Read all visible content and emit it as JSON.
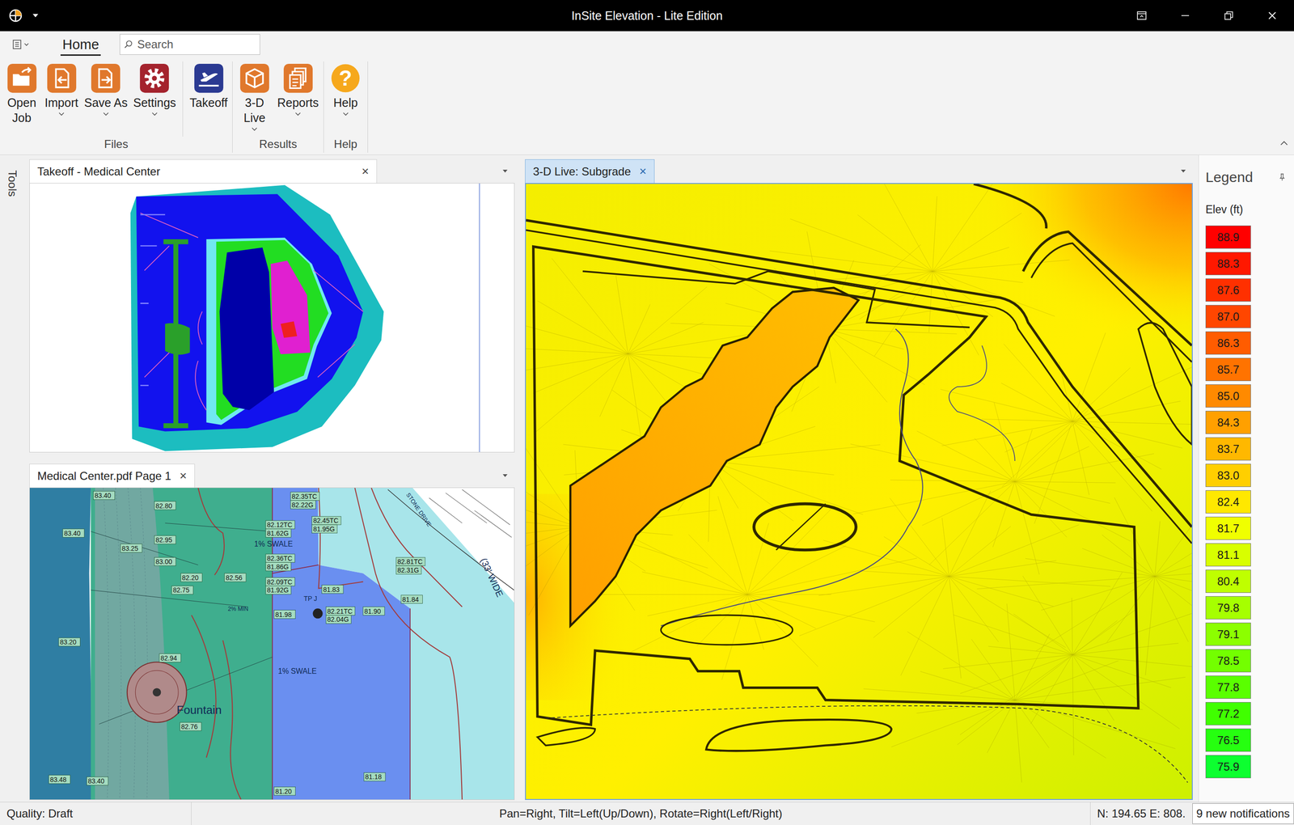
{
  "window": {
    "title": "InSite Elevation - Lite Edition"
  },
  "ribbon": {
    "tabs": [
      {
        "label": "Home",
        "selected": true
      }
    ],
    "search": {
      "placeholder": "Search"
    },
    "groups": [
      {
        "label": "Files",
        "buttons": [
          {
            "lines": [
              "Open",
              "Job"
            ],
            "kind": "open",
            "color": "#e0782c",
            "dropdown": false,
            "separator": false,
            "glyph": ""
          },
          {
            "lines": [
              "Import"
            ],
            "kind": "import",
            "color": "#e0782c",
            "dropdown": true,
            "separator": false,
            "glyph": ""
          },
          {
            "lines": [
              "Save As"
            ],
            "kind": "saveas",
            "color": "#e0782c",
            "dropdown": true,
            "separator": false,
            "glyph": ""
          },
          {
            "lines": [
              "Settings"
            ],
            "kind": "settings",
            "color": "#a4232d",
            "dropdown": true,
            "separator": false,
            "glyph": ""
          },
          {
            "lines": [
              "Takeoff"
            ],
            "kind": "takeoff",
            "color": "#2b3a92",
            "dropdown": false,
            "separator": true,
            "glyph": ""
          }
        ]
      },
      {
        "label": "Results",
        "buttons": [
          {
            "lines": [
              "3-D",
              "Live"
            ],
            "kind": "live3d",
            "color": "#e0782c",
            "dropdown": true,
            "separator": false,
            "glyph": ""
          },
          {
            "lines": [
              "Reports"
            ],
            "kind": "reports",
            "color": "#e0782c",
            "dropdown": true,
            "separator": false,
            "glyph": ""
          }
        ]
      },
      {
        "label": "Help",
        "buttons": [
          {
            "lines": [
              "Help"
            ],
            "kind": "help",
            "color": "#f6a81c",
            "dropdown": true,
            "separator": false,
            "glyph": "?"
          }
        ]
      }
    ]
  },
  "tools": {
    "label": "Tools"
  },
  "takeoff_panel": {
    "tab": {
      "label": "Takeoff - Medical Center",
      "close": "×",
      "selected": false
    }
  },
  "pdf_panel": {
    "tab": {
      "label": "Medical Center.pdf Page 1",
      "close": "×",
      "selected": false
    },
    "labels": [
      {
        "text": "83.40",
        "kind": "spot"
      },
      {
        "text": "82.80",
        "kind": "spot"
      },
      {
        "text": "83.40",
        "kind": "spot"
      },
      {
        "text": "83.25",
        "kind": "spot"
      },
      {
        "text": "82.95",
        "kind": "spot"
      },
      {
        "text": "83.00",
        "kind": "spot"
      },
      {
        "text": "82.20",
        "kind": "spot"
      },
      {
        "text": "82.56",
        "kind": "spot"
      },
      {
        "text": "82.75",
        "kind": "spot"
      },
      {
        "text": "83.20",
        "kind": "spot"
      },
      {
        "text": "82.94",
        "kind": "spot"
      },
      {
        "text": "82.76",
        "kind": "spot"
      },
      {
        "text": "83.48",
        "kind": "spot"
      },
      {
        "text": "83.40",
        "kind": "spot"
      },
      {
        "text": "82.35TC",
        "kind": "spot"
      },
      {
        "text": "82.22G",
        "kind": "spot"
      },
      {
        "text": "82.12TC",
        "kind": "spot"
      },
      {
        "text": "81.62G",
        "kind": "spot"
      },
      {
        "text": "82.45TC",
        "kind": "spot"
      },
      {
        "text": "81.95G",
        "kind": "spot"
      },
      {
        "text": "1% SWALE",
        "kind": "note"
      },
      {
        "text": "82.36TC",
        "kind": "spot"
      },
      {
        "text": "81.86G",
        "kind": "spot"
      },
      {
        "text": "82.09TC",
        "kind": "spot"
      },
      {
        "text": "81.92G",
        "kind": "spot"
      },
      {
        "text": "81.83",
        "kind": "spot"
      },
      {
        "text": "81.98",
        "kind": "spot"
      },
      {
        "text": "TP J",
        "kind": "note"
      },
      {
        "text": "82.21TC",
        "kind": "spot"
      },
      {
        "text": "82.04G",
        "kind": "spot"
      },
      {
        "text": "81.90",
        "kind": "spot"
      },
      {
        "text": "82.81TC",
        "kind": "spot"
      },
      {
        "text": "82.31G",
        "kind": "spot"
      },
      {
        "text": "81.84",
        "kind": "spot"
      },
      {
        "text": "2% MIN",
        "kind": "note"
      },
      {
        "text": "1% SWALE",
        "kind": "note"
      },
      {
        "text": "Fountain",
        "kind": "note"
      },
      {
        "text": "81.18",
        "kind": "spot"
      },
      {
        "text": "81.20",
        "kind": "spot"
      },
      {
        "text": "STONE DRIVE",
        "kind": "note"
      },
      {
        "text": "(33' WIDE",
        "kind": "note"
      }
    ]
  },
  "view3d": {
    "tab": {
      "label": "3-D Live: Subgrade",
      "close": "×",
      "selected": true
    }
  },
  "legend": {
    "title": "Legend",
    "unit": "Elev (ft)",
    "items": [
      {
        "value": "88.9",
        "color": "#ff0000"
      },
      {
        "value": "88.3",
        "color": "#ff1800"
      },
      {
        "value": "87.6",
        "color": "#ff3000"
      },
      {
        "value": "87.0",
        "color": "#ff4600"
      },
      {
        "value": "86.3",
        "color": "#ff5c00"
      },
      {
        "value": "85.7",
        "color": "#ff7300"
      },
      {
        "value": "85.0",
        "color": "#ff8a00"
      },
      {
        "value": "84.3",
        "color": "#ffa000"
      },
      {
        "value": "83.7",
        "color": "#ffb800"
      },
      {
        "value": "83.0",
        "color": "#ffcf00"
      },
      {
        "value": "82.4",
        "color": "#ffe800"
      },
      {
        "value": "81.7",
        "color": "#f0ff00"
      },
      {
        "value": "81.1",
        "color": "#d8ff00"
      },
      {
        "value": "80.4",
        "color": "#bfff00"
      },
      {
        "value": "79.8",
        "color": "#a6ff00"
      },
      {
        "value": "79.1",
        "color": "#8cff00"
      },
      {
        "value": "78.5",
        "color": "#73ff00"
      },
      {
        "value": "77.8",
        "color": "#5aff00"
      },
      {
        "value": "77.2",
        "color": "#40ff00"
      },
      {
        "value": "76.5",
        "color": "#26ff10"
      },
      {
        "value": "75.9",
        "color": "#0dff30"
      }
    ]
  },
  "status_bar": {
    "quality": "Quality: Draft",
    "hint": "Pan=Right, Tilt=Left(Up/Down), Rotate=Right(Left/Right)",
    "coords": "N: 194.65 E: 808.",
    "notifications": "9 new notifications"
  }
}
